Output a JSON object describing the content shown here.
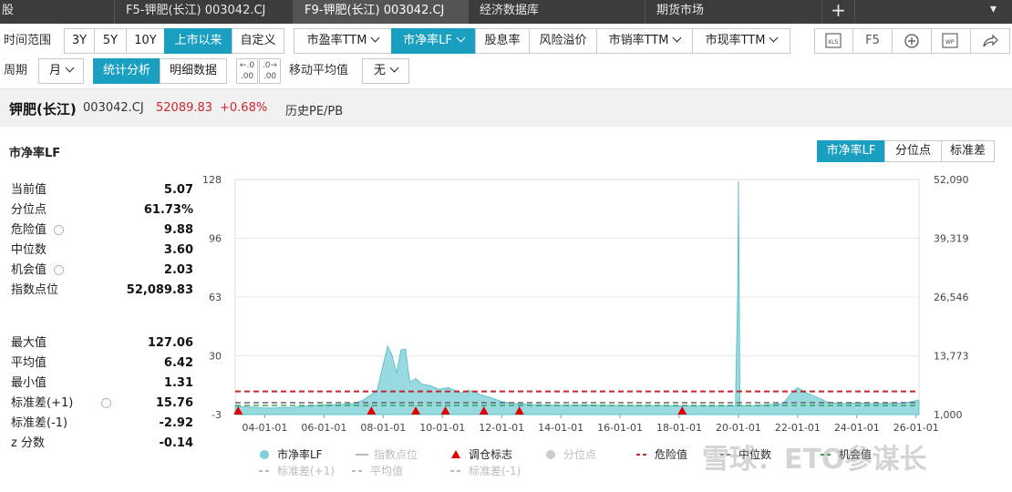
{
  "tabs": [
    {
      "label": "股",
      "active": false
    },
    {
      "label": "F5-钾肥(长江) 003042.CJ",
      "active": false
    },
    {
      "label": "F9-钾肥(长江) 003042.CJ",
      "active": true
    },
    {
      "label": "经济数据库",
      "active": false
    },
    {
      "label": "期货市场",
      "active": false
    }
  ],
  "toolbar": {
    "range_label": "时间范围",
    "range_options": [
      "3Y",
      "5Y",
      "10Y",
      "上市以来",
      "自定义"
    ],
    "range_selected": "上市以来",
    "metrics": [
      "市盈率TTM",
      "市净率LF",
      "股息率",
      "风险溢价",
      "市销率TTM",
      "市现率TTM"
    ],
    "metric_selected": "市净率LF",
    "icons": [
      "xls-icon",
      "F5",
      "add-circle-icon",
      "wp-icon",
      "share-icon"
    ],
    "f5_label": "F5",
    "period_label": "周期",
    "period_value": "月",
    "view_options": [
      "统计分析",
      "明细数据"
    ],
    "view_selected": "统计分析",
    "ma_label": "移动平均值",
    "ma_value": "无"
  },
  "header": {
    "name": "钾肥(长江)",
    "code": "003042.CJ",
    "price": "52089.83",
    "change": "+0.68%",
    "title": "历史PE/PB"
  },
  "section": {
    "title": "市净率LF",
    "segments": [
      "市净率LF",
      "分位点",
      "标准差"
    ],
    "segment_selected": "市净率LF"
  },
  "stats_top": [
    {
      "label": "当前值",
      "value": "5.07",
      "gear": false
    },
    {
      "label": "分位点",
      "value": "61.73%",
      "gear": false
    },
    {
      "label": "危险值",
      "value": "9.88",
      "gear": true
    },
    {
      "label": "中位数",
      "value": "3.60",
      "gear": false
    },
    {
      "label": "机会值",
      "value": "2.03",
      "gear": true
    },
    {
      "label": "指数点位",
      "value": "52,089.83",
      "gear": false
    }
  ],
  "stats_bottom": [
    {
      "label": "最大值",
      "value": "127.06",
      "gear": false
    },
    {
      "label": "平均值",
      "value": "6.42",
      "gear": false
    },
    {
      "label": "最小值",
      "value": "1.31",
      "gear": false
    },
    {
      "label": "标准差(+1)",
      "value": "15.76",
      "gear": true
    },
    {
      "label": "标准差(-1)",
      "value": "-2.92",
      "gear": false
    },
    {
      "label": "z 分数",
      "value": "-0.14",
      "gear": false
    }
  ],
  "chart_data": {
    "type": "area",
    "left_ticks": [
      "128",
      "96",
      "63",
      "30",
      "-3"
    ],
    "right_ticks": [
      "52,090",
      "39,319",
      "26,546",
      "13,773",
      "1,000"
    ],
    "x_ticks": [
      "04-01-01",
      "06-01-01",
      "08-01-01",
      "10-01-01",
      "12-01-01",
      "14-01-01",
      "16-01-01",
      "18-01-01",
      "20-01-01",
      "22-01-01",
      "24-01-01",
      "26-01-01"
    ],
    "x_range": [
      2003.0,
      2026.1
    ],
    "ylim": [
      -3,
      128
    ],
    "series": [
      {
        "name": "市净率LF",
        "color": "#7fd0d8",
        "points": [
          [
            2003.0,
            1.5
          ],
          [
            2003.3,
            1.3
          ],
          [
            2003.8,
            0.8
          ],
          [
            2004.2,
            0.6
          ],
          [
            2004.6,
            0.9
          ],
          [
            2005.0,
            1.0
          ],
          [
            2005.5,
            1.8
          ],
          [
            2006.0,
            2.4
          ],
          [
            2006.5,
            2.6
          ],
          [
            2007.0,
            3.0
          ],
          [
            2007.3,
            4.8
          ],
          [
            2007.6,
            8.0
          ],
          [
            2007.8,
            10.5
          ],
          [
            2008.0,
            25.0
          ],
          [
            2008.15,
            35.0
          ],
          [
            2008.3,
            30.0
          ],
          [
            2008.45,
            20.0
          ],
          [
            2008.6,
            33.0
          ],
          [
            2008.75,
            33.5
          ],
          [
            2008.9,
            15.0
          ],
          [
            2009.1,
            17.0
          ],
          [
            2009.3,
            14.0
          ],
          [
            2009.6,
            13.0
          ],
          [
            2009.9,
            11.0
          ],
          [
            2010.2,
            12.0
          ],
          [
            2010.6,
            9.0
          ],
          [
            2010.9,
            10.5
          ],
          [
            2011.3,
            8.0
          ],
          [
            2011.7,
            6.0
          ],
          [
            2012.0,
            4.2
          ],
          [
            2012.5,
            3.0
          ],
          [
            2013.0,
            2.6
          ],
          [
            2014.0,
            2.2
          ],
          [
            2015.0,
            2.3
          ],
          [
            2016.0,
            2.0
          ],
          [
            2017.0,
            2.0
          ],
          [
            2018.0,
            1.8
          ],
          [
            2019.0,
            1.7
          ],
          [
            2019.9,
            1.8
          ],
          [
            2019.98,
            70.0
          ],
          [
            2020.0,
            127.06
          ],
          [
            2020.05,
            2.0
          ],
          [
            2020.6,
            2.0
          ],
          [
            2021.0,
            2.5
          ],
          [
            2021.5,
            3.0
          ],
          [
            2021.8,
            9.0
          ],
          [
            2022.0,
            12.0
          ],
          [
            2022.3,
            9.0
          ],
          [
            2022.6,
            7.0
          ],
          [
            2023.0,
            4.0
          ],
          [
            2023.5,
            3.0
          ],
          [
            2024.0,
            3.5
          ],
          [
            2024.5,
            3.0
          ],
          [
            2025.0,
            3.2
          ],
          [
            2025.6,
            3.4
          ],
          [
            2026.1,
            5.07
          ]
        ]
      }
    ],
    "danger": 9.88,
    "median": 3.6,
    "opportunity": 2.03,
    "rebalance_markers": [
      2003.1,
      2007.6,
      2009.1,
      2010.1,
      2011.4,
      2012.6,
      2018.1
    ],
    "legend": [
      {
        "label": "市净率LF",
        "kind": "dot",
        "color": "#7fd0d8"
      },
      {
        "label": "指数点位",
        "kind": "line",
        "color": "#bbbbbb"
      },
      {
        "label": "调仓标志",
        "kind": "triangle",
        "color": "#e00000"
      },
      {
        "label": "分位点",
        "kind": "dot",
        "color": "#cccccc"
      },
      {
        "label": "危险值",
        "kind": "dash",
        "color": "#c0282d"
      },
      {
        "label": "中位数",
        "kind": "dash",
        "color": "#888888"
      },
      {
        "label": "机会值",
        "kind": "dash",
        "color": "#2e9e57"
      },
      {
        "label": "标准差(+1)",
        "kind": "dash",
        "color": "#bbbbbb"
      },
      {
        "label": "平均值",
        "kind": "dash",
        "color": "#bbbbbb"
      },
      {
        "label": "标准差(-1)",
        "kind": "dash",
        "color": "#bbbbbb"
      }
    ]
  },
  "watermark": "雪球：ETO参谋长"
}
